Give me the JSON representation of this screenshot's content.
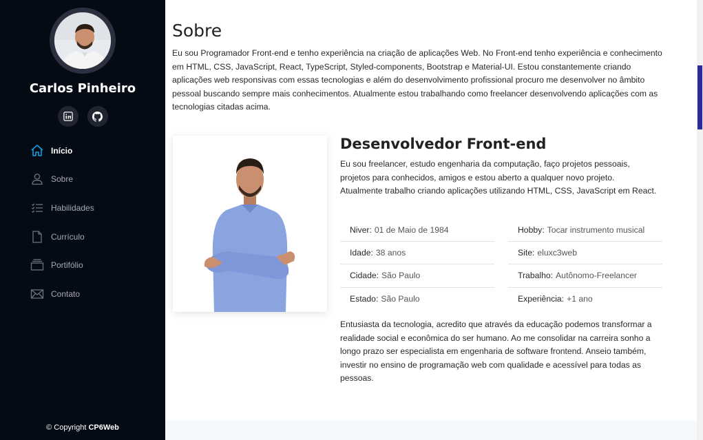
{
  "profile": {
    "name": "Carlos Pinheiro",
    "avatar_alt": "Carlos Pinheiro"
  },
  "social": [
    {
      "icon": "linkedin-icon"
    },
    {
      "icon": "github-icon"
    }
  ],
  "nav": {
    "items": [
      {
        "label": "Início",
        "icon": "home-icon",
        "active": true
      },
      {
        "label": "Sobre",
        "icon": "user-icon"
      },
      {
        "label": "Habilidades",
        "icon": "list-icon"
      },
      {
        "label": "Currículo",
        "icon": "file-icon"
      },
      {
        "label": "Portifólio",
        "icon": "portfolio-icon"
      },
      {
        "label": "Contato",
        "icon": "envelope-icon"
      }
    ]
  },
  "footer": {
    "prefix": "© Copyright ",
    "brand": "CP6Web"
  },
  "about": {
    "title": "Sobre",
    "description": "Eu sou Programador Front-end e tenho experiência na criação de aplicações Web. No Front-end tenho experiência e conhecimento em HTML, CSS, JavaScript, React, TypeScript, Styled-components, Bootstrap e Material-UI. Estou constantemente criando aplicações web responsivas com essas tecnologias e além do desenvolvimento profissional procuro me desenvolver no âmbito pessoal buscando sempre mais conhecimentos. Atualmente estou trabalhando como freelancer desenvolvendo aplicações com as tecnologias citadas acima.",
    "role_title": "Desenvolvedor Front-end",
    "role_desc": "Eu sou freelancer, estudo engenharia da computação, faço projetos pessoais, projetos para conhecidos, amigos e estou aberto a qualquer novo projeto. Atualmente trabalho criando aplicações utilizando HTML, CSS, JavaScript em React.",
    "info_left": [
      {
        "key": "Niver:",
        "value": "01 de Maio de 1984"
      },
      {
        "key": "Idade:",
        "value": "38 anos"
      },
      {
        "key": "Cidade:",
        "value": "São Paulo"
      },
      {
        "key": "Estado:",
        "value": "São Paulo"
      }
    ],
    "info_right": [
      {
        "key": "Hobby:",
        "value": "Tocar instrumento musical"
      },
      {
        "key": "Site:",
        "value": "eluxc3web"
      },
      {
        "key": "Trabalho:",
        "value": "Autônomo-Freelancer"
      },
      {
        "key": "Experiência:",
        "value": "+1 ano"
      }
    ],
    "bottom_desc": "Entusiasta da tecnologia, acredito que através da educação podemos transformar a realidade social e econômica do ser humano. Ao me consolidar na carreira sonho a longo prazo ser especialista em engenharia de software frontend. Anseio também, investir no ensino de programação web com qualidade e acessível para todas as pessoas."
  },
  "colors": {
    "sidebar_bg": "#040b14",
    "accent": "#149ddd",
    "scroll_thumb": "#2c2aa0"
  }
}
